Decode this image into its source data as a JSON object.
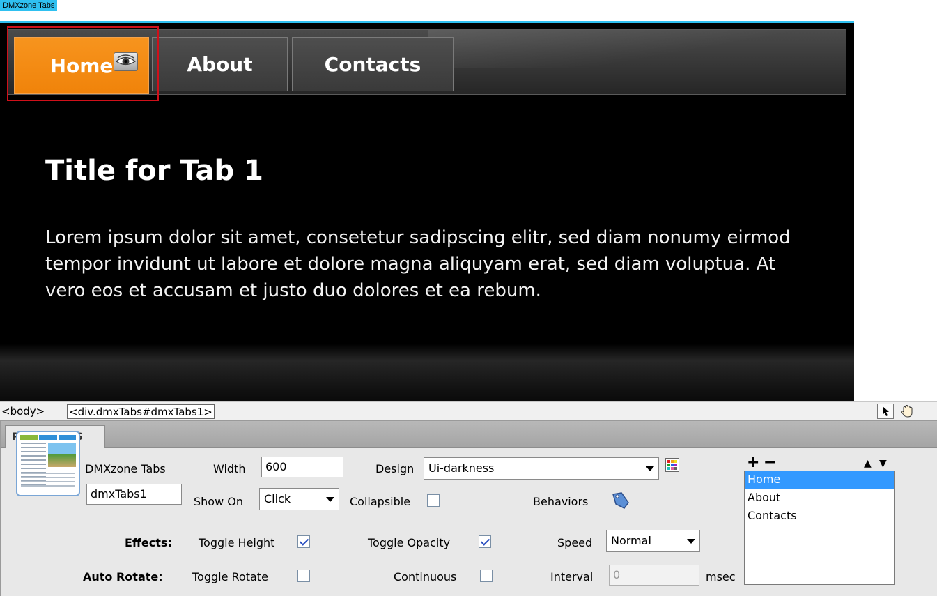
{
  "widget": {
    "label": "DMXzone Tabs",
    "tabs": [
      {
        "label": "Home",
        "active": true
      },
      {
        "label": "About",
        "active": false
      },
      {
        "label": "Contacts",
        "active": false
      }
    ],
    "panel": {
      "title": "Title for Tab 1",
      "body": "Lorem ipsum dolor sit amet, consetetur sadipscing elitr, sed diam nonumy eirmod tempor invidunt ut labore et dolore magna aliquyam erat, sed diam voluptua. At vero eos et accusam et justo duo dolores et ea rebum."
    },
    "colors": {
      "active_tab": "#f7941e",
      "background": "#000000",
      "selection_outline": "#d0101a"
    }
  },
  "tag_selector": {
    "tags": [
      "<body>",
      "<div.dmxTabs#dmxTabs1>"
    ],
    "tools": [
      "pointer-icon",
      "hand-icon"
    ]
  },
  "properties": {
    "tab_label": "PROPERTIES",
    "component_name": "DMXzone Tabs",
    "id_value": "dmxTabs1",
    "width_label": "Width",
    "width_value": "600",
    "design_label": "Design",
    "design_value": "Ui-darkness",
    "show_on_label": "Show On",
    "show_on_value": "Click",
    "collapsible_label": "Collapsible",
    "collapsible_checked": false,
    "behaviors_label": "Behaviors",
    "effects_label": "Effects:",
    "toggle_height_label": "Toggle Height",
    "toggle_height_checked": true,
    "toggle_opacity_label": "Toggle Opacity",
    "toggle_opacity_checked": true,
    "speed_label": "Speed",
    "speed_value": "Normal",
    "auto_rotate_label": "Auto Rotate:",
    "toggle_rotate_label": "Toggle Rotate",
    "toggle_rotate_checked": false,
    "continuous_label": "Continuous",
    "continuous_checked": false,
    "interval_label": "Interval",
    "interval_value": "0",
    "msec_label": "msec",
    "list_add": "+",
    "list_remove": "−",
    "list_up": "▲",
    "list_down": "▼",
    "tab_list": [
      "Home",
      "About",
      "Contacts"
    ],
    "tab_list_selected": "Home"
  }
}
